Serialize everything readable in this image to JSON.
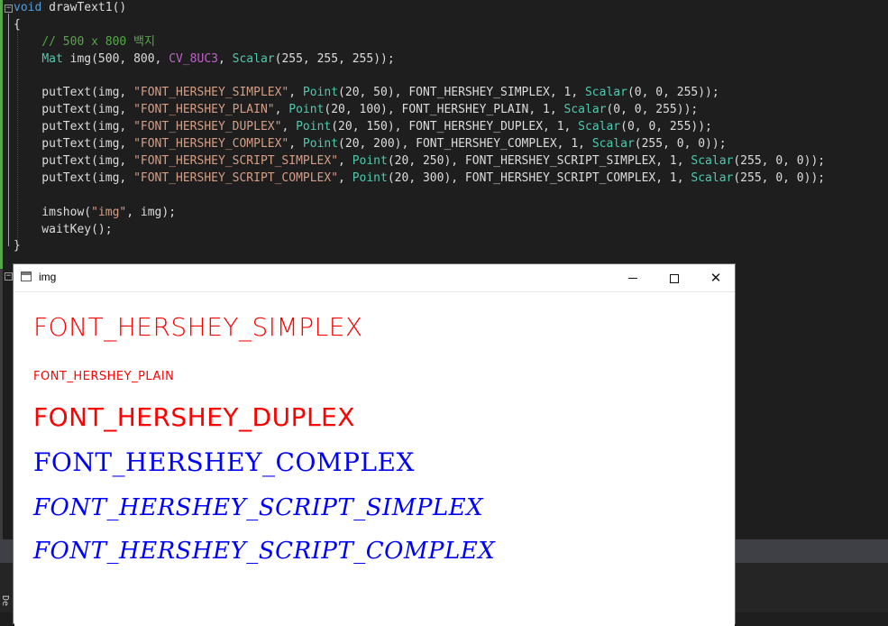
{
  "editor": {
    "lines": [
      {
        "parts": [
          [
            "kw",
            "void"
          ],
          [
            "fn",
            " drawText1()"
          ]
        ]
      },
      {
        "parts": [
          [
            "pl",
            "{"
          ]
        ]
      },
      {
        "parts": [
          [
            "pl",
            "    "
          ],
          [
            "cm",
            "// 500 x 800 백지"
          ]
        ]
      },
      {
        "parts": [
          [
            "pl",
            "    "
          ],
          [
            "ty",
            "Mat"
          ],
          [
            "pl",
            " img(500, 800, "
          ],
          [
            "mac",
            "CV_8UC3"
          ],
          [
            "pl",
            ", "
          ],
          [
            "ty",
            "Scalar"
          ],
          [
            "pl",
            "(255, 255, 255));"
          ]
        ]
      },
      {
        "parts": [
          [
            "pl",
            ""
          ]
        ]
      },
      {
        "parts": [
          [
            "pl",
            "    putText(img, "
          ],
          [
            "str",
            "\"FONT_HERSHEY_SIMPLEX\""
          ],
          [
            "pl",
            ", "
          ],
          [
            "ty",
            "Point"
          ],
          [
            "pl",
            "(20, 50), FONT_HERSHEY_SIMPLEX, 1, "
          ],
          [
            "ty",
            "Scalar"
          ],
          [
            "pl",
            "(0, 0, 255));"
          ]
        ]
      },
      {
        "parts": [
          [
            "pl",
            "    putText(img, "
          ],
          [
            "str",
            "\"FONT_HERSHEY_PLAIN\""
          ],
          [
            "pl",
            ", "
          ],
          [
            "ty",
            "Point"
          ],
          [
            "pl",
            "(20, 100), FONT_HERSHEY_PLAIN, 1, "
          ],
          [
            "ty",
            "Scalar"
          ],
          [
            "pl",
            "(0, 0, 255));"
          ]
        ]
      },
      {
        "parts": [
          [
            "pl",
            "    putText(img, "
          ],
          [
            "str",
            "\"FONT_HERSHEY_DUPLEX\""
          ],
          [
            "pl",
            ", "
          ],
          [
            "ty",
            "Point"
          ],
          [
            "pl",
            "(20, 150), FONT_HERSHEY_DUPLEX, 1, "
          ],
          [
            "ty",
            "Scalar"
          ],
          [
            "pl",
            "(0, 0, 255));"
          ]
        ]
      },
      {
        "parts": [
          [
            "pl",
            "    putText(img, "
          ],
          [
            "str",
            "\"FONT_HERSHEY_COMPLEX\""
          ],
          [
            "pl",
            ", "
          ],
          [
            "ty",
            "Point"
          ],
          [
            "pl",
            "(20, 200), FONT_HERSHEY_COMPLEX, 1, "
          ],
          [
            "ty",
            "Scalar"
          ],
          [
            "pl",
            "(255, 0, 0));"
          ]
        ]
      },
      {
        "parts": [
          [
            "pl",
            "    putText(img, "
          ],
          [
            "str",
            "\"FONT_HERSHEY_SCRIPT_SIMPLEX\""
          ],
          [
            "pl",
            ", "
          ],
          [
            "ty",
            "Point"
          ],
          [
            "pl",
            "(20, 250), FONT_HERSHEY_SCRIPT_SIMPLEX, 1, "
          ],
          [
            "ty",
            "Scalar"
          ],
          [
            "pl",
            "(255, 0, 0));"
          ]
        ]
      },
      {
        "parts": [
          [
            "pl",
            "    putText(img, "
          ],
          [
            "str",
            "\"FONT_HERSHEY_SCRIPT_COMPLEX\""
          ],
          [
            "pl",
            ", "
          ],
          [
            "ty",
            "Point"
          ],
          [
            "pl",
            "(20, 300), FONT_HERSHEY_SCRIPT_COMPLEX, 1, "
          ],
          [
            "ty",
            "Scalar"
          ],
          [
            "pl",
            "(255, 0, 0));"
          ]
        ]
      },
      {
        "parts": [
          [
            "pl",
            ""
          ]
        ]
      },
      {
        "parts": [
          [
            "pl",
            "    imshow("
          ],
          [
            "str",
            "\"img\""
          ],
          [
            "pl",
            ", img);"
          ]
        ]
      },
      {
        "parts": [
          [
            "pl",
            "    waitKey();"
          ]
        ]
      },
      {
        "parts": [
          [
            "pl",
            "}"
          ]
        ]
      }
    ],
    "fold_collapse_glyph": "−"
  },
  "window": {
    "title": "img",
    "icon": "app-window-icon",
    "controls": {
      "minimize": "minimize-icon",
      "maximize": "maximize-icon",
      "close": "✕"
    }
  },
  "canvas_texts": [
    "FONT_HERSHEY_SIMPLEX",
    "FONT_HERSHEY_PLAIN",
    "FONT_HERSHEY_DUPLEX",
    "FONT_HERSHEY_COMPLEX",
    "FONT_HERSHEY_SCRIPT_SIMPLEX",
    "FONT_HERSHEY_SCRIPT_COMPLEX"
  ],
  "colors": {
    "editor_bg": "#1e1e1e",
    "red_text": "#ff0000",
    "blue_text": "#0000ff"
  },
  "side_label": "De"
}
